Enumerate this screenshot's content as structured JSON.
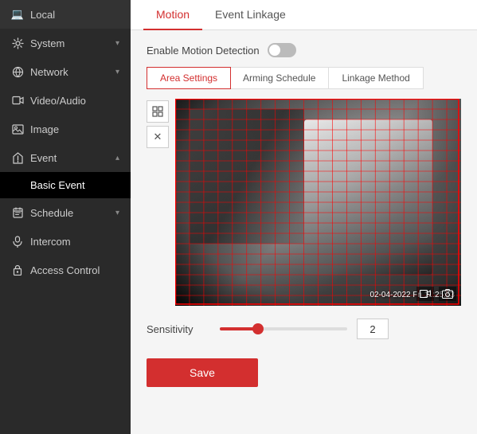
{
  "sidebar": {
    "items": [
      {
        "id": "local",
        "label": "Local",
        "icon": "💻",
        "hasChevron": false,
        "active": false
      },
      {
        "id": "system",
        "label": "System",
        "icon": "⚙",
        "hasChevron": true,
        "active": false
      },
      {
        "id": "network",
        "label": "Network",
        "icon": "🌐",
        "hasChevron": true,
        "active": false
      },
      {
        "id": "video-audio",
        "label": "Video/Audio",
        "icon": "🎬",
        "hasChevron": false,
        "active": false
      },
      {
        "id": "image",
        "label": "Image",
        "icon": "🖼",
        "hasChevron": false,
        "active": false
      },
      {
        "id": "event",
        "label": "Event",
        "icon": "⚡",
        "hasChevron": true,
        "active": false
      },
      {
        "id": "basic-event",
        "label": "Basic Event",
        "isSubItem": true,
        "active": true
      },
      {
        "id": "schedule",
        "label": "Schedule",
        "icon": "📋",
        "hasChevron": true,
        "active": false
      },
      {
        "id": "intercom",
        "label": "Intercom",
        "icon": "🎤",
        "hasChevron": false,
        "active": false
      },
      {
        "id": "access-control",
        "label": "Access Control",
        "icon": "🔒",
        "hasChevron": false,
        "active": false
      }
    ]
  },
  "topTabs": [
    {
      "id": "motion",
      "label": "Motion",
      "active": true
    },
    {
      "id": "event-linkage",
      "label": "Event Linkage",
      "active": false
    }
  ],
  "enableRow": {
    "label": "Enable Motion Detection",
    "enabled": false
  },
  "subTabs": [
    {
      "id": "area-settings",
      "label": "Area Settings",
      "active": true
    },
    {
      "id": "arming-schedule",
      "label": "Arming Schedule",
      "active": false
    },
    {
      "id": "linkage-method",
      "label": "Linkage Method",
      "active": false
    }
  ],
  "tools": [
    {
      "id": "grid-tool",
      "icon": "⊞"
    },
    {
      "id": "clear-tool",
      "icon": "✕"
    }
  ],
  "camera": {
    "timestamp": "02-04-2022 Fri 11:25:43"
  },
  "sensitivity": {
    "label": "Sensitivity",
    "value": "2",
    "percent": 30
  },
  "saveButton": {
    "label": "Save"
  }
}
